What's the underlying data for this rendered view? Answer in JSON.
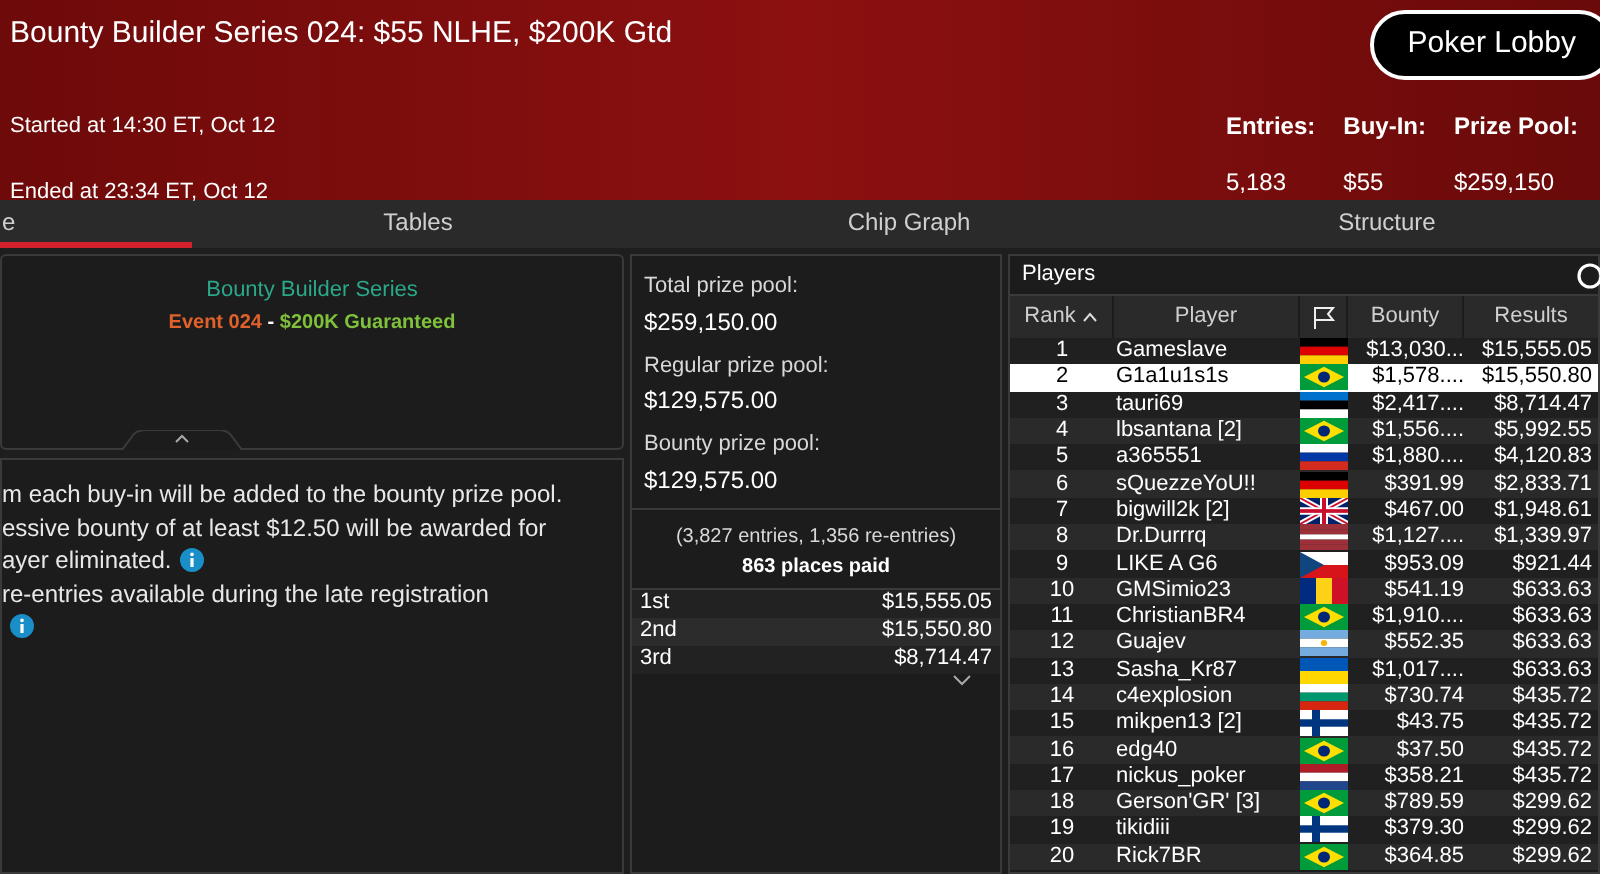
{
  "header": {
    "title": "Bounty Builder Series 024: $55 NLHE, $200K Gtd",
    "started": "Started at 14:30 ET, Oct 12",
    "ended": "Ended at 23:34 ET, Oct 12",
    "lobby_button": "Poker Lobby",
    "stats": [
      {
        "label": "Entries:",
        "value": "5,183"
      },
      {
        "label": "Buy-In:",
        "value": "$55"
      },
      {
        "label": "Prize Pool:",
        "value": "$259,150"
      }
    ]
  },
  "tabs": [
    {
      "label": "e",
      "selected": true
    },
    {
      "label": "Tables",
      "selected": false
    },
    {
      "label": "Chip Graph",
      "selected": false
    },
    {
      "label": "Structure",
      "selected": false
    }
  ],
  "event_card": {
    "series": "Bounty Builder Series",
    "event": "Event 024",
    "separator": "-",
    "guarantee": "$200K Guaranteed"
  },
  "info_lines": [
    {
      "text": "m each buy-in will be added to the bounty prize pool.",
      "info": false
    },
    {
      "text": "essive bounty of at least $12.50 will be awarded for",
      "info": false
    },
    {
      "text": "ayer eliminated.",
      "info": true
    },
    {
      "text": "re-entries available during the late registration",
      "info": false
    },
    {
      "info": true
    }
  ],
  "prize_pools": [
    {
      "label": "Total prize pool:",
      "value": "$259,150.00"
    },
    {
      "label": "Regular prize pool:",
      "value": "$129,575.00"
    },
    {
      "label": "Bounty prize pool:",
      "value": "$129,575.00"
    }
  ],
  "entries_note": "(3,827 entries, 1,356 re-entries)",
  "places_paid": "863 places paid",
  "payouts": [
    {
      "place": "1st",
      "amount": "$15,555.05"
    },
    {
      "place": "2nd",
      "amount": "$15,550.80"
    },
    {
      "place": "3rd",
      "amount": "$8,714.47"
    }
  ],
  "players": {
    "title": "Players",
    "columns": [
      "Rank",
      "Player",
      "Bounty",
      "Results"
    ],
    "rows": [
      {
        "rank": "1",
        "player": "Gameslave",
        "flag": {
          "kind": "de"
        },
        "bounty": "$13,030...",
        "results": "$15,555.05",
        "selected": false
      },
      {
        "rank": "2",
        "player": "G1a1u1s1s",
        "flag": {
          "kind": "br"
        },
        "bounty": "$1,578....",
        "results": "$15,550.80",
        "selected": true
      },
      {
        "rank": "3",
        "player": "tauri69",
        "flag": {
          "kind": "ee"
        },
        "bounty": "$2,417....",
        "results": "$8,714.47",
        "selected": false
      },
      {
        "rank": "4",
        "player": "lbsantana [2]",
        "flag": {
          "kind": "br"
        },
        "bounty": "$1,556....",
        "results": "$5,992.55",
        "selected": false
      },
      {
        "rank": "5",
        "player": "a365551",
        "flag": {
          "kind": "ru"
        },
        "bounty": "$1,880....",
        "results": "$4,120.83",
        "selected": false
      },
      {
        "rank": "6",
        "player": "sQuezzeYoU!!",
        "flag": {
          "kind": "de"
        },
        "bounty": "$391.99",
        "results": "$2,833.71",
        "selected": false
      },
      {
        "rank": "7",
        "player": "bigwill2k [2]",
        "flag": {
          "kind": "gb"
        },
        "bounty": "$467.00",
        "results": "$1,948.61",
        "selected": false
      },
      {
        "rank": "8",
        "player": "Dr.Durrrq",
        "flag": {
          "kind": "lv"
        },
        "bounty": "$1,127....",
        "results": "$1,339.97",
        "selected": false
      },
      {
        "rank": "9",
        "player": "LIKE A G6",
        "flag": {
          "kind": "cz"
        },
        "bounty": "$953.09",
        "results": "$921.44",
        "selected": false
      },
      {
        "rank": "10",
        "player": "GMSimio23",
        "flag": {
          "kind": "ro"
        },
        "bounty": "$541.19",
        "results": "$633.63",
        "selected": false
      },
      {
        "rank": "11",
        "player": "ChristianBR4",
        "flag": {
          "kind": "br"
        },
        "bounty": "$1,910....",
        "results": "$633.63",
        "selected": false
      },
      {
        "rank": "12",
        "player": "Guajev",
        "flag": {
          "kind": "ar"
        },
        "bounty": "$552.35",
        "results": "$633.63",
        "selected": false
      },
      {
        "rank": "13",
        "player": "Sasha_Kr87",
        "flag": {
          "kind": "ua"
        },
        "bounty": "$1,017....",
        "results": "$633.63",
        "selected": false
      },
      {
        "rank": "14",
        "player": "c4explosion",
        "flag": {
          "kind": "bg"
        },
        "bounty": "$730.74",
        "results": "$435.72",
        "selected": false
      },
      {
        "rank": "15",
        "player": "mikpen13 [2]",
        "flag": {
          "kind": "fi"
        },
        "bounty": "$43.75",
        "results": "$435.72",
        "selected": false
      },
      {
        "rank": "16",
        "player": "edg40",
        "flag": {
          "kind": "br"
        },
        "bounty": "$37.50",
        "results": "$435.72",
        "selected": false
      },
      {
        "rank": "17",
        "player": "nickus_poker",
        "flag": {
          "kind": "nl"
        },
        "bounty": "$358.21",
        "results": "$435.72",
        "selected": false
      },
      {
        "rank": "18",
        "player": "Gerson'GR' [3]",
        "flag": {
          "kind": "br"
        },
        "bounty": "$789.59",
        "results": "$299.62",
        "selected": false
      },
      {
        "rank": "19",
        "player": "tikidiii",
        "flag": {
          "kind": "fi"
        },
        "bounty": "$379.30",
        "results": "$299.62",
        "selected": false
      },
      {
        "rank": "20",
        "player": "Rick7BR",
        "flag": {
          "kind": "br"
        },
        "bounty": "$364.85",
        "results": "$299.62",
        "selected": false
      }
    ]
  }
}
